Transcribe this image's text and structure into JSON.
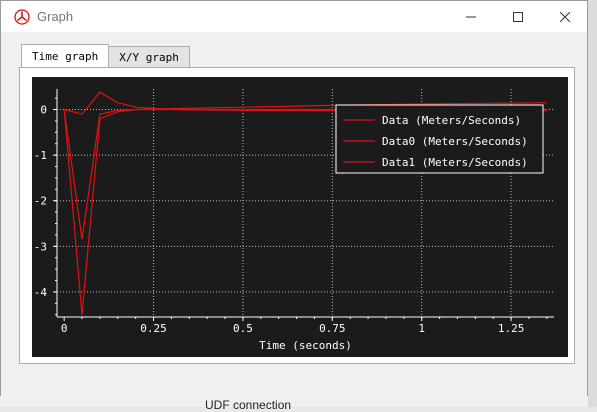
{
  "window": {
    "title": "Graph",
    "min_label": "—",
    "max_label": "☐",
    "close_label": "✕"
  },
  "tabs": [
    {
      "label": "Time graph",
      "active": true
    },
    {
      "label": "X/Y graph",
      "active": false
    }
  ],
  "background": {
    "partial_text": "UDF connection"
  },
  "colors": {
    "plot_background": "#1b1b1b",
    "series": "#e01010",
    "grid": "#bdbdbd",
    "text": "#ffffff"
  },
  "chart_data": {
    "type": "line",
    "title": "",
    "xlabel": "Time (seconds)",
    "ylabel": "",
    "xlim": [
      -0.02,
      1.37
    ],
    "ylim": [
      -4.55,
      0.45
    ],
    "x_ticks": [
      0,
      0.25,
      0.5,
      0.75,
      1,
      1.25
    ],
    "x_tick_labels": [
      "0",
      "0.25",
      "0.5",
      "0.75",
      "1",
      "1.25"
    ],
    "y_ticks": [
      0,
      -1,
      -2,
      -3,
      -4
    ],
    "y_tick_labels": [
      "0",
      "-1",
      "-2",
      "-3",
      "-4"
    ],
    "grid": true,
    "legend_position": "top-right",
    "series": [
      {
        "name": "Data (Meters/Seconds)",
        "x": [
          0,
          0.05,
          0.1,
          0.15,
          0.2,
          0.3,
          0.5,
          0.75,
          1.0,
          1.25,
          1.35
        ],
        "y": [
          0,
          -2.85,
          -0.1,
          -0.02,
          0.0,
          0.02,
          0.05,
          0.09,
          0.12,
          0.14,
          0.15
        ]
      },
      {
        "name": "Data0 (Meters/Seconds)",
        "x": [
          0,
          0.05,
          0.1,
          0.15,
          0.2,
          0.3,
          0.5,
          0.75,
          1.0,
          1.25,
          1.35
        ],
        "y": [
          0,
          -4.5,
          -0.2,
          -0.05,
          0.0,
          0.0,
          0.0,
          0.0,
          0.0,
          0.0,
          0.0
        ]
      },
      {
        "name": "Data1 (Meters/Seconds)",
        "x": [
          0,
          0.05,
          0.1,
          0.15,
          0.2,
          0.3,
          0.5,
          0.75,
          1.0,
          1.25,
          1.35
        ],
        "y": [
          0,
          -0.1,
          0.38,
          0.15,
          0.05,
          0.0,
          -0.02,
          -0.02,
          -0.02,
          -0.02,
          -0.02
        ]
      }
    ]
  }
}
